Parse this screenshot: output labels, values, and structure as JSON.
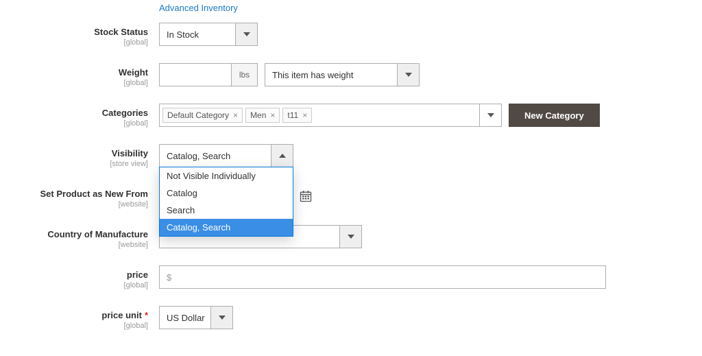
{
  "links": {
    "advanced_inventory": "Advanced Inventory"
  },
  "stock_status": {
    "label": "Stock Status",
    "scope": "[global]",
    "value": "In Stock"
  },
  "weight": {
    "label": "Weight",
    "scope": "[global]",
    "value": "",
    "unit": "lbs",
    "has_weight_value": "This item has weight"
  },
  "categories": {
    "label": "Categories",
    "scope": "[global]",
    "tags": [
      "Default Category",
      "Men",
      "t11"
    ],
    "new_button": "New Category"
  },
  "visibility": {
    "label": "Visibility",
    "scope": "[store view]",
    "value": "Catalog, Search",
    "options": [
      {
        "label": "Not Visible Individually",
        "selected": false
      },
      {
        "label": "Catalog",
        "selected": false
      },
      {
        "label": "Search",
        "selected": false
      },
      {
        "label": "Catalog, Search",
        "selected": true
      }
    ]
  },
  "new_from": {
    "label": "Set Product as New From",
    "scope": "[website]",
    "value": ""
  },
  "country": {
    "label": "Country of Manufacture",
    "scope": "[website]",
    "value": ""
  },
  "price": {
    "label": "price",
    "scope": "[global]",
    "prefix": "$",
    "value": ""
  },
  "price_unit": {
    "label": "price unit",
    "scope": "[global]",
    "required": true,
    "value": "US Dollar"
  }
}
